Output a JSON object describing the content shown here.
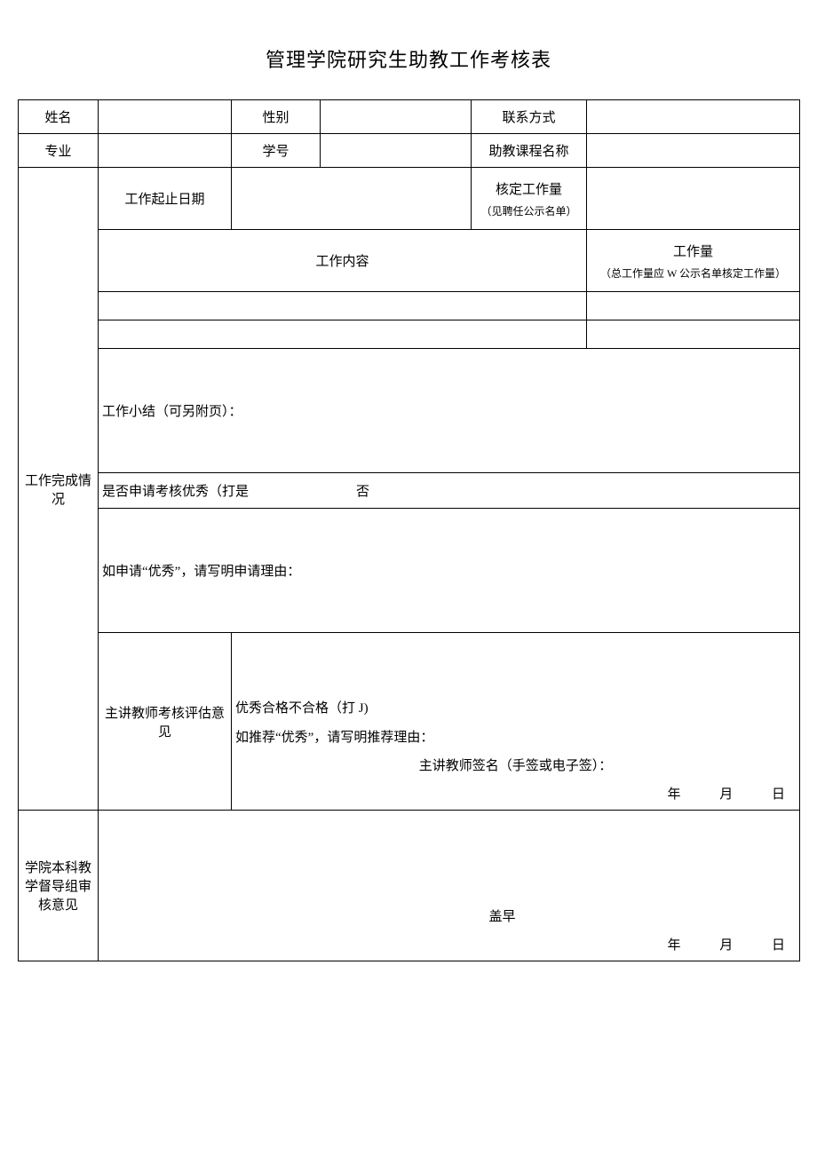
{
  "title": "管理学院研究生助教工作考核表",
  "labels": {
    "name": "姓名",
    "gender": "性别",
    "contact": "联系方式",
    "major": "专业",
    "studentId": "学号",
    "courseName": "助教课程名称",
    "workPeriod": "工作起止日期",
    "approvedWorkload": "核定工作量",
    "approvedWorkloadNote": "（见聘任公示名单）",
    "workContent": "工作内容",
    "workload": "工作量",
    "workloadNote": "（总工作量应 W 公示名单核定工作量）",
    "workSummary": "工作小结（可另附页）：",
    "applyExcellentPrefix": "是否申请考核优秀（打是",
    "applyExcellentNo": "否",
    "applyReason": "如申请“优秀”，请写明申请理由：",
    "completion": "工作完成情况",
    "teacherOpinion": "主讲教师考核评估意见",
    "gradeLine": "优秀合格不合格（打 J)",
    "recommendReason": "如推荐“优秀”，请写明推荐理由：",
    "teacherSign": "主讲教师签名（手签或电子签）：",
    "collegeOpinion": "学院本科教学督导组审核意见",
    "seal": "盖早",
    "year": "年",
    "month": "月",
    "day": "日"
  }
}
